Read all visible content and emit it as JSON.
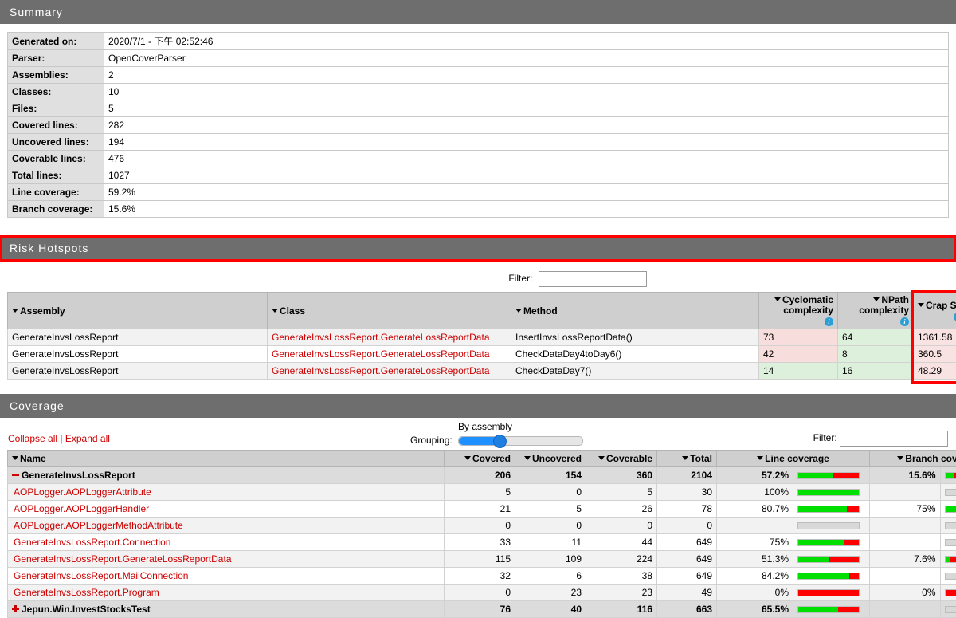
{
  "sections": {
    "summary_title": "Summary",
    "risk_title": "Risk Hotspots",
    "coverage_title": "Coverage"
  },
  "summary": {
    "rows": [
      {
        "label": "Generated on:",
        "value": "2020/7/1 - 下午 02:52:46"
      },
      {
        "label": "Parser:",
        "value": "OpenCoverParser"
      },
      {
        "label": "Assemblies:",
        "value": "2"
      },
      {
        "label": "Classes:",
        "value": "10"
      },
      {
        "label": "Files:",
        "value": "5"
      },
      {
        "label": "Covered lines:",
        "value": "282"
      },
      {
        "label": "Uncovered lines:",
        "value": "194"
      },
      {
        "label": "Coverable lines:",
        "value": "476"
      },
      {
        "label": "Total lines:",
        "value": "1027"
      },
      {
        "label": "Line coverage:",
        "value": "59.2%"
      },
      {
        "label": "Branch coverage:",
        "value": "15.6%"
      }
    ]
  },
  "risk": {
    "filter_label": "Filter:",
    "filter_value": "",
    "filter_placeholder": "",
    "headers": {
      "assembly": "Assembly",
      "class": "Class",
      "method": "Method",
      "cyclomatic_line1": "Cyclomatic",
      "cyclomatic_line2": "complexity",
      "npath_line1": "NPath",
      "npath_line2": "complexity",
      "crap": "Crap Score"
    },
    "rows": [
      {
        "assembly": "GenerateInvsLossReport",
        "class": "GenerateInvsLossReport.GenerateLossReportData",
        "method": "InsertInvsLossReportData()",
        "cyclomatic": "73",
        "npath": "64",
        "crap": "1361.58"
      },
      {
        "assembly": "GenerateInvsLossReport",
        "class": "GenerateInvsLossReport.GenerateLossReportData",
        "method": "CheckDataDay4toDay6()",
        "cyclomatic": "42",
        "npath": "8",
        "crap": "360.5"
      },
      {
        "assembly": "GenerateInvsLossReport",
        "class": "GenerateInvsLossReport.GenerateLossReportData",
        "method": "CheckDataDay7()",
        "cyclomatic": "14",
        "npath": "16",
        "crap": "48.29"
      }
    ]
  },
  "coverage": {
    "collapse_all": "Collapse all",
    "separator": "|",
    "expand_all": "Expand all",
    "grouping_label": "Grouping:",
    "grouping_value": "By assembly",
    "filter_label": "Filter:",
    "filter_value": "",
    "filter_placeholder": "",
    "headers": {
      "name": "Name",
      "covered": "Covered",
      "uncovered": "Uncovered",
      "coverable": "Coverable",
      "total": "Total",
      "line_coverage": "Line coverage",
      "branch_coverage": "Branch coverage"
    },
    "rows": [
      {
        "type": "group",
        "icon": "minus-icon",
        "name": "GenerateInvsLossReport",
        "covered": "206",
        "uncovered": "154",
        "coverable": "360",
        "total": "2104",
        "line_coverage": "57.2%",
        "line_pct": 57.2,
        "branch_coverage": "15.6%",
        "branch_pct": 15.6
      },
      {
        "type": "class",
        "name": "AOPLogger.AOPLoggerAttribute",
        "covered": "5",
        "uncovered": "0",
        "coverable": "5",
        "total": "30",
        "line_coverage": "100%",
        "line_pct": 100,
        "branch_coverage": "",
        "branch_pct": null
      },
      {
        "type": "class",
        "name": "AOPLogger.AOPLoggerHandler",
        "covered": "21",
        "uncovered": "5",
        "coverable": "26",
        "total": "78",
        "line_coverage": "80.7%",
        "line_pct": 80.7,
        "branch_coverage": "75%",
        "branch_pct": 75
      },
      {
        "type": "class",
        "name": "AOPLogger.AOPLoggerMethodAttribute",
        "covered": "0",
        "uncovered": "0",
        "coverable": "0",
        "total": "0",
        "line_coverage": "",
        "line_pct": null,
        "branch_coverage": "",
        "branch_pct": null
      },
      {
        "type": "class",
        "name": "GenerateInvsLossReport.Connection",
        "covered": "33",
        "uncovered": "11",
        "coverable": "44",
        "total": "649",
        "line_coverage": "75%",
        "line_pct": 75,
        "branch_coverage": "",
        "branch_pct": null
      },
      {
        "type": "class",
        "name": "GenerateInvsLossReport.GenerateLossReportData",
        "covered": "115",
        "uncovered": "109",
        "coverable": "224",
        "total": "649",
        "line_coverage": "51.3%",
        "line_pct": 51.3,
        "branch_coverage": "7.6%",
        "branch_pct": 7.6
      },
      {
        "type": "class",
        "name": "GenerateInvsLossReport.MailConnection",
        "covered": "32",
        "uncovered": "6",
        "coverable": "38",
        "total": "649",
        "line_coverage": "84.2%",
        "line_pct": 84.2,
        "branch_coverage": "",
        "branch_pct": null
      },
      {
        "type": "class",
        "name": "GenerateInvsLossReport.Program",
        "covered": "0",
        "uncovered": "23",
        "coverable": "23",
        "total": "49",
        "line_coverage": "0%",
        "line_pct": 0,
        "branch_coverage": "0%",
        "branch_pct": 0
      },
      {
        "type": "group",
        "icon": "plus-icon",
        "name": "Jepun.Win.InvestStocksTest",
        "covered": "76",
        "uncovered": "40",
        "coverable": "116",
        "total": "663",
        "line_coverage": "65.5%",
        "line_pct": 65.5,
        "branch_coverage": "",
        "branch_pct": null
      }
    ]
  },
  "colors": {
    "header_bar": "#6e6e6e",
    "accent_red": "#ff0000",
    "link_red": "#cc0000",
    "bar_green": "#00e000",
    "bar_red": "#ff0000",
    "info_blue": "#2a9fd6"
  }
}
